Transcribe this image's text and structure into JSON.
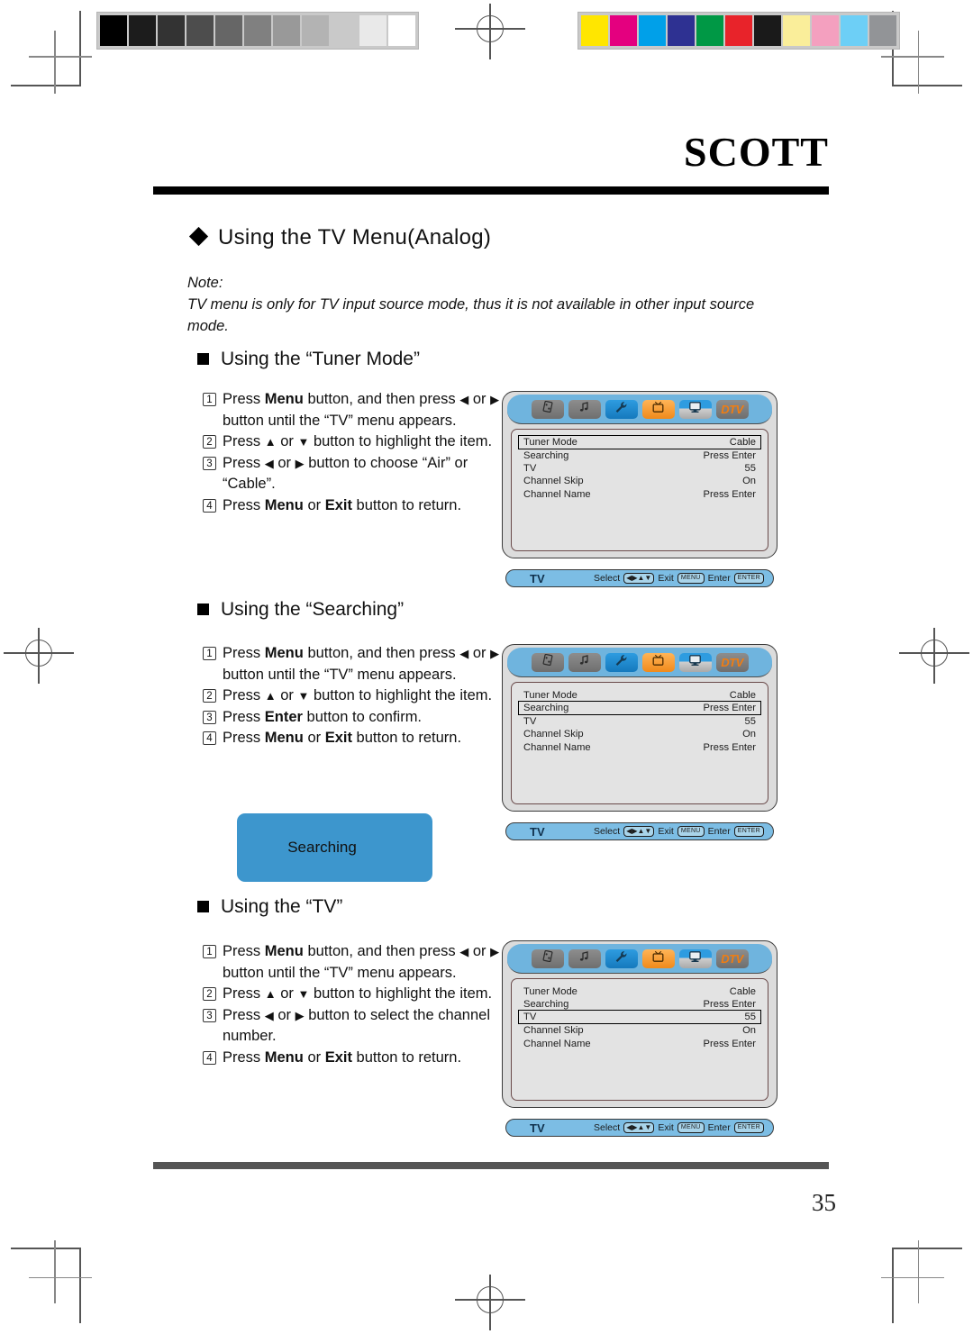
{
  "brand": "SCOTT",
  "page_number": "35",
  "title": "Using the TV Menu(Analog)",
  "note": {
    "label": "Note:",
    "text": "TV menu is only for TV input source mode, thus it is not available in other input source mode."
  },
  "sections": [
    {
      "heading": "Using the “Tuner Mode”",
      "steps": [
        {
          "num": "1",
          "html": "Press <b>Menu</b> button, and then press <span class=\"ar\">◀</span> or <span class=\"ar\">▶</span> button until the “TV” menu appears."
        },
        {
          "num": "2",
          "html": "Press <span class=\"ar\">▲</span> or <span class=\"ar\">▼</span> button to highlight the item."
        },
        {
          "num": "3",
          "html": "Press <span class=\"ar\">◀</span> or <span class=\"ar\">▶</span> button to choose “Air” or “Cable”."
        },
        {
          "num": "4",
          "html": "Press <b>Menu</b> or <b>Exit</b> button to return."
        }
      ]
    },
    {
      "heading": "Using the “Searching”",
      "steps": [
        {
          "num": "1",
          "html": "Press <b>Menu</b> button, and then press <span class=\"ar\">◀</span> or <span class=\"ar\">▶</span> button until the “TV” menu appears."
        },
        {
          "num": "2",
          "html": "Press <span class=\"ar\">▲</span> or <span class=\"ar\">▼</span> button to highlight the item."
        },
        {
          "num": "3",
          "html": "Press <b>Enter</b> button to confirm."
        },
        {
          "num": "4",
          "html": "Press <b>Menu</b> or <b>Exit</b> button to return."
        }
      ]
    },
    {
      "heading": "Using the “TV”",
      "steps": [
        {
          "num": "1",
          "html": "Press <b>Menu</b> button, and then press <span class=\"ar\">◀</span> or <span class=\"ar\">▶</span> button until the “TV” menu appears."
        },
        {
          "num": "2",
          "html": "Press <span class=\"ar\">▲</span> or <span class=\"ar\">▼</span> button to highlight the item."
        },
        {
          "num": "3",
          "html": "Press <span class=\"ar\">◀</span> or <span class=\"ar\">▶</span> button to select the channel number."
        },
        {
          "num": "4",
          "html": "Press <b>Menu</b> or <b>Exit</b> button to return."
        }
      ]
    }
  ],
  "searching_popup": {
    "label": "Searching",
    "color": "#3d96cd"
  },
  "osd": {
    "tabs": [
      {
        "name": "picture-tab",
        "icon": "film-icon",
        "style": "gray",
        "glyph": "▧"
      },
      {
        "name": "audio-tab",
        "icon": "music-note-icon",
        "style": "gray",
        "glyph": "♫"
      },
      {
        "name": "setup-tab",
        "icon": "wrench-icon",
        "style": "blue",
        "glyph": "🔧"
      },
      {
        "name": "tv-tab",
        "icon": "television-icon",
        "style": "orange",
        "glyph": "▣"
      },
      {
        "name": "display-tab",
        "icon": "monitor-icon",
        "style": "mon",
        "glyph": "▣"
      },
      {
        "name": "dtv-tab",
        "icon": "dtv-icon",
        "style": "dtv",
        "glyph": "DTV"
      }
    ],
    "rows": [
      {
        "label": "Tuner Mode",
        "value": "Cable"
      },
      {
        "label": "Searching",
        "value": "Press Enter"
      },
      {
        "label": "TV",
        "value": "55"
      },
      {
        "label": "Channel Skip",
        "value": "On"
      },
      {
        "label": "Channel Name",
        "value": "Press Enter"
      }
    ],
    "footer": {
      "source": "TV",
      "select_label": "Select",
      "exit_label": "Exit",
      "exit_key": "MENU",
      "enter_label": "Enter",
      "enter_key": "ENTER"
    },
    "selected_indices": [
      0,
      1,
      2
    ]
  },
  "calibration": {
    "grayscale": [
      "#000000",
      "#1c1c1c",
      "#333333",
      "#4d4d4d",
      "#666666",
      "#808080",
      "#999999",
      "#b3b3b3",
      "#c9c9c9",
      "#e9e9e9",
      "#ffffff"
    ],
    "colors": [
      "#ffe600",
      "#e4007f",
      "#00a0e9",
      "#2e3192",
      "#009845",
      "#e8232a",
      "#1a1a1a",
      "#faee9a",
      "#f4a0bf",
      "#6dcff6",
      "#929497"
    ]
  }
}
